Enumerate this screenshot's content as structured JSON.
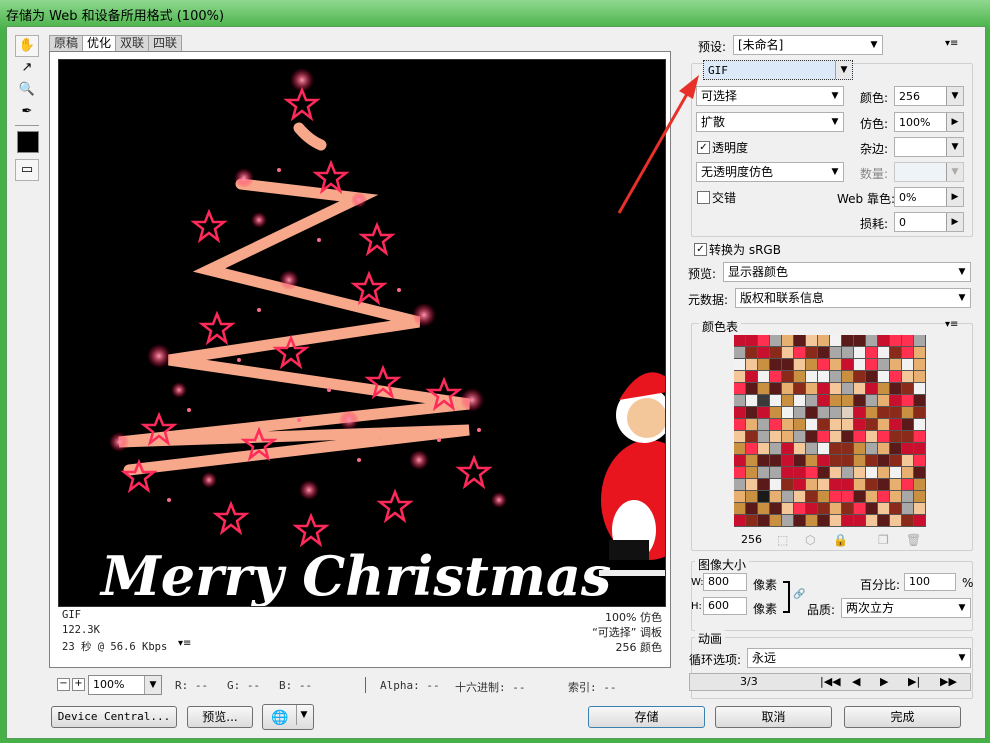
{
  "window": {
    "title": "存储为 Web 和设备所用格式 (100%)"
  },
  "tabs": [
    "原稿",
    "优化",
    "双联",
    "四联"
  ],
  "preview": {
    "text": "Merry Christmas",
    "info_left": [
      "GIF",
      "122.3K",
      "23 秒 @ 56.6 Kbps"
    ],
    "info_right": [
      "100% 仿色",
      "“可选择” 调板",
      "256 颜色"
    ]
  },
  "settings": {
    "preset_label": "预设:",
    "preset_value": "[未命名]",
    "format": "GIF",
    "reduction": "可选择",
    "colors_label": "颜色:",
    "colors_value": "256",
    "dither_algo": "扩散",
    "dither_label": "仿色:",
    "dither_value": "100%",
    "transparency_label": "透明度",
    "matte_label": "杂边:",
    "trans_dither": "无透明度仿色",
    "amount_label": "数量:",
    "interlaced_label": "交错",
    "websnap_label": "Web 靠色:",
    "websnap_value": "0%",
    "lossy_label": "损耗:",
    "lossy_value": "0",
    "srgb_label": "转换为 sRGB",
    "preview_label": "预览:",
    "preview_value": "显示器颜色",
    "metadata_label": "元数据:",
    "metadata_value": "版权和联系信息"
  },
  "color_table": {
    "title": "颜色表",
    "count": "256"
  },
  "image_size": {
    "title": "图像大小",
    "w_label": "W:",
    "w_value": "800",
    "w_unit": "像素",
    "h_label": "H:",
    "h_value": "600",
    "h_unit": "像素",
    "percent_label": "百分比:",
    "percent_value": "100",
    "percent_unit": "%",
    "quality_label": "品质:",
    "quality_value": "两次立方"
  },
  "animation": {
    "title": "动画",
    "loop_label": "循环选项:",
    "loop_value": "永远",
    "frame": "3/3"
  },
  "status_bar": {
    "zoom": "100%",
    "r": "R: --",
    "g": "G: --",
    "b": "B: --",
    "alpha": "Alpha: --",
    "hex": "十六进制: --",
    "index": "索引: --"
  },
  "buttons": {
    "device_central": "Device Central...",
    "preview": "预览...",
    "save": "存储",
    "cancel": "取消",
    "done": "完成"
  },
  "colors": {
    "accent_arrow": "#e8302a",
    "title_green": "#46b146"
  }
}
